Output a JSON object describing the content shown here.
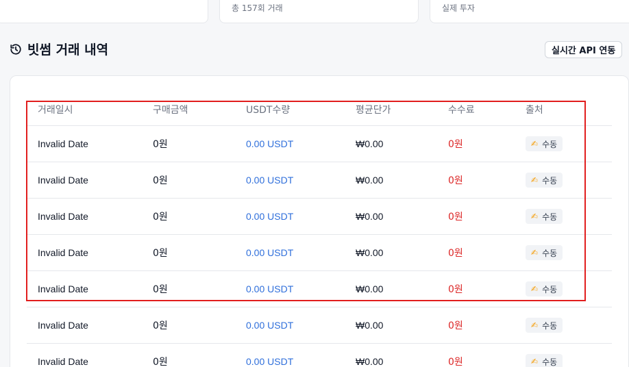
{
  "stats": {
    "cards": [
      {
        "sub": ""
      },
      {
        "sub": "총 157회 거래"
      },
      {
        "sub": "실제 투자"
      }
    ]
  },
  "section": {
    "title": "빗썸 거래 내역",
    "icon": "history-icon",
    "api_badge": "실시간 API 연동"
  },
  "table": {
    "columns": [
      "거래일시",
      "구매금액",
      "USDT수량",
      "평균단가",
      "수수료",
      "출처"
    ],
    "rows": [
      {
        "date": "Invalid Date",
        "amount": "0원",
        "usdt": "0.00 USDT",
        "avg": "₩0.00",
        "fee": "0원",
        "source": "수동",
        "source_icon": "writing-hand-icon"
      },
      {
        "date": "Invalid Date",
        "amount": "0원",
        "usdt": "0.00 USDT",
        "avg": "₩0.00",
        "fee": "0원",
        "source": "수동",
        "source_icon": "writing-hand-icon"
      },
      {
        "date": "Invalid Date",
        "amount": "0원",
        "usdt": "0.00 USDT",
        "avg": "₩0.00",
        "fee": "0원",
        "source": "수동",
        "source_icon": "writing-hand-icon"
      },
      {
        "date": "Invalid Date",
        "amount": "0원",
        "usdt": "0.00 USDT",
        "avg": "₩0.00",
        "fee": "0원",
        "source": "수동",
        "source_icon": "writing-hand-icon"
      },
      {
        "date": "Invalid Date",
        "amount": "0원",
        "usdt": "0.00 USDT",
        "avg": "₩0.00",
        "fee": "0원",
        "source": "수동",
        "source_icon": "writing-hand-icon"
      },
      {
        "date": "Invalid Date",
        "amount": "0원",
        "usdt": "0.00 USDT",
        "avg": "₩0.00",
        "fee": "0원",
        "source": "수동",
        "source_icon": "writing-hand-icon"
      },
      {
        "date": "Invalid Date",
        "amount": "0원",
        "usdt": "0.00 USDT",
        "avg": "₩0.00",
        "fee": "0원",
        "source": "수동",
        "source_icon": "writing-hand-icon"
      }
    ]
  },
  "colors": {
    "usdt": "#2f6fdb",
    "fee": "#dc2626",
    "highlight": "#e11d1d"
  }
}
